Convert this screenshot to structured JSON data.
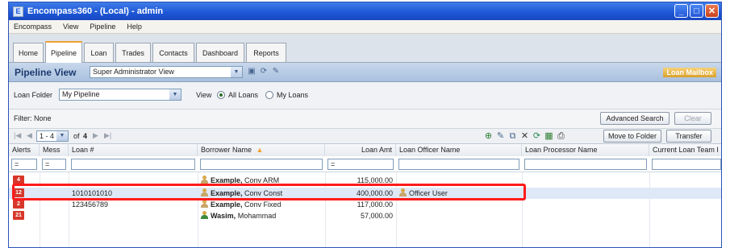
{
  "window": {
    "title": "Encompass360 - (Local) - admin",
    "app_icon": "E",
    "minimize": "_",
    "maximize": "□",
    "close": "✕"
  },
  "menubar": [
    "Encompass",
    "View",
    "Pipeline",
    "Help"
  ],
  "tabs": [
    {
      "label": "Home"
    },
    {
      "label": "Pipeline",
      "active": true
    },
    {
      "label": "Loan"
    },
    {
      "label": "Trades"
    },
    {
      "label": "Contacts"
    },
    {
      "label": "Dashboard"
    },
    {
      "label": "Reports"
    }
  ],
  "pipeline_view": {
    "title": "Pipeline View",
    "view_select": "Super Administrator View",
    "mailbox_link": "Loan Mailbox"
  },
  "loan_folder": {
    "label": "Loan Folder",
    "value": "My Pipeline",
    "view_label": "View",
    "radio_all": "All Loans",
    "radio_mine": "My Loans"
  },
  "filter": {
    "label": "Filter: None",
    "advanced_search": "Advanced Search",
    "clear": "Clear"
  },
  "pager": {
    "range": "1 - 4",
    "of_text": "of",
    "total": "4",
    "move_to_folder": "Move to Folder",
    "transfer": "Transfer"
  },
  "columns": [
    "Alerts",
    "Mess",
    "Loan #",
    "Borrower Name",
    "Loan Amt",
    "Loan Officer Name",
    "Loan Processor Name",
    "Current Loan Team I"
  ],
  "sort_indicator": "▲",
  "filter_row": [
    "=",
    "=",
    "",
    "",
    "=",
    "",
    "",
    ""
  ],
  "rows": [
    {
      "alert": "4",
      "loan_no": "",
      "borrower_last": "Example,",
      "borrower_first": "Conv ARM",
      "amount": "115,000.00",
      "officer": ""
    },
    {
      "alert": "12",
      "loan_no": "1010101010",
      "borrower_last": "Example,",
      "borrower_first": "Conv Const",
      "amount": "400,000.00",
      "officer": "Officer User"
    },
    {
      "alert": "2",
      "loan_no": "123456789",
      "borrower_last": "Example,",
      "borrower_first": "Conv Fixed",
      "amount": "117,000.00",
      "officer": ""
    },
    {
      "alert": "21",
      "loan_no": "",
      "borrower_last": "Wasim,",
      "borrower_first": "Mohammad",
      "amount": "57,000.00",
      "officer": ""
    }
  ],
  "colors": {
    "title_bar": "#1d56d6",
    "alert_badge": "#d7372a",
    "highlight": "#ff1a1a",
    "selected_row": "#dfe8f6"
  }
}
